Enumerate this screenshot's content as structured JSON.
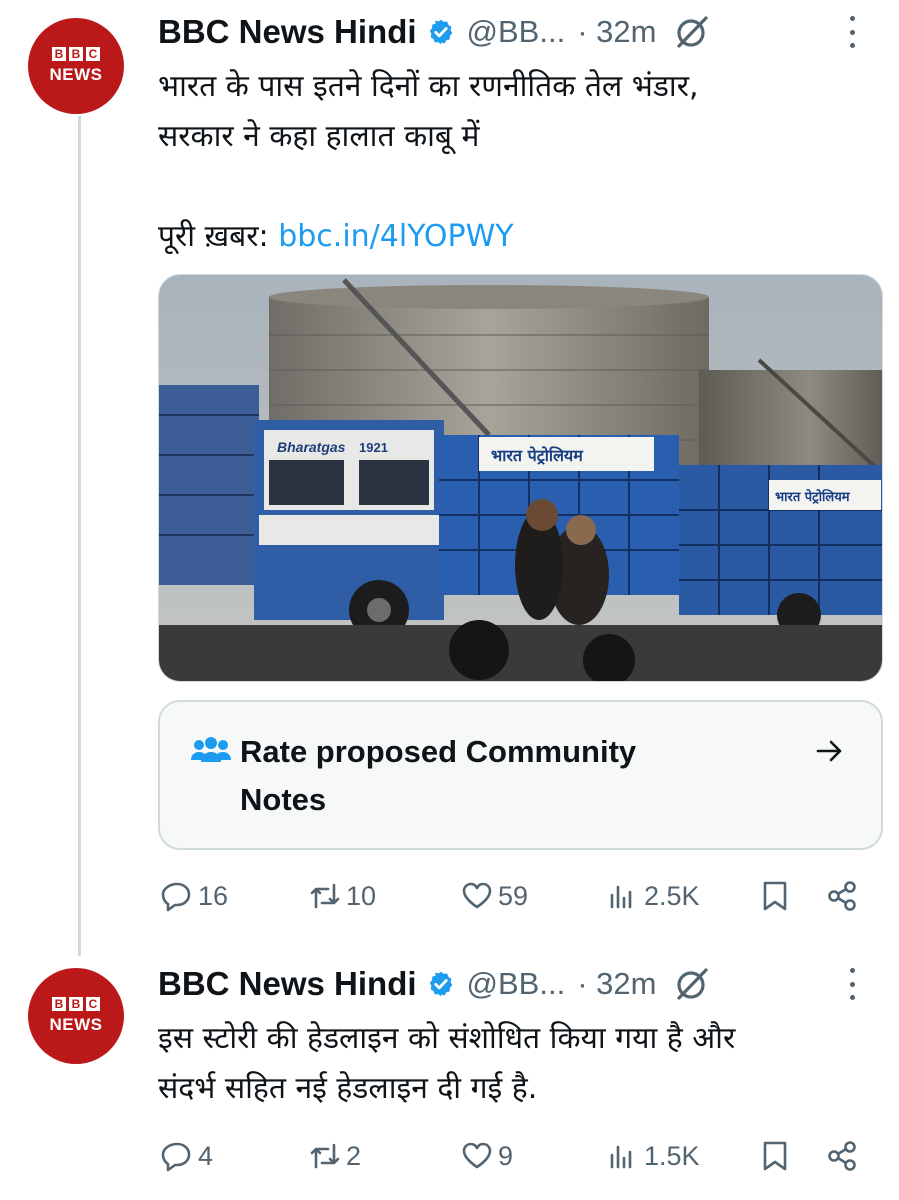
{
  "tweets": [
    {
      "avatar": {
        "top_letters": [
          "B",
          "B",
          "C"
        ],
        "bottom_word": "NEWS"
      },
      "name": "BBC News Hindi",
      "handle": "@BB...",
      "time": "· 32m",
      "text_line1": "भारत के पास इतने दिनों का रणनीतिक तेल भंडार,",
      "text_line2": "सरकार ने कहा हालात काबू में",
      "link_prefix": "पूरी ख़बर: ",
      "link": "bbc.in/4lYOPWY",
      "image_signs": {
        "truck_sign": "भारत पेट्रोलियम",
        "truck_sign2": "भारत पेट्रोलियम",
        "cab_text": "Bharatgas",
        "cab_number": "1921"
      },
      "community_note": {
        "label_line1": "Rate proposed Community",
        "label_line2": "Notes"
      },
      "replies": "16",
      "retweets": "10",
      "likes": "59",
      "views": "2.5K"
    },
    {
      "avatar": {
        "top_letters": [
          "B",
          "B",
          "C"
        ],
        "bottom_word": "NEWS"
      },
      "name": "BBC News Hindi",
      "handle": "@BB...",
      "time": "· 32m",
      "text_line1": "इस स्टोरी की हेडलाइन को संशोधित किया गया है और",
      "text_line2": "संदर्भ सहित नई हेडलाइन दी गई है.",
      "replies": "4",
      "retweets": "2",
      "likes": "9",
      "views": "1.5K"
    }
  ],
  "colors": {
    "bbc_red": "#bb1919",
    "link_blue": "#1d9bf0",
    "muted": "#536471",
    "border": "#cfd9de"
  }
}
